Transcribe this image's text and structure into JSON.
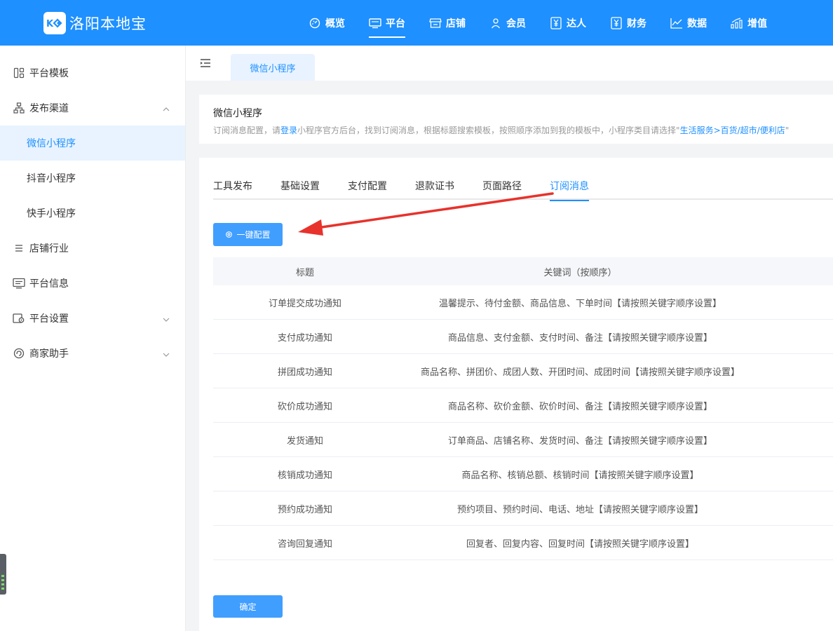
{
  "brand": {
    "name": "洛阳本地宝",
    "logo_icon": "ko-logo-icon"
  },
  "topnav": [
    {
      "label": "概览",
      "icon": "dashboard-icon",
      "active": false
    },
    {
      "label": "平台",
      "icon": "monitor-icon",
      "active": true
    },
    {
      "label": "店铺",
      "icon": "store-icon",
      "active": false
    },
    {
      "label": "会员",
      "icon": "user-icon",
      "active": false
    },
    {
      "label": "达人",
      "icon": "yen-icon",
      "active": false
    },
    {
      "label": "财务",
      "icon": "yen-icon",
      "active": false
    },
    {
      "label": "数据",
      "icon": "line-chart-icon",
      "active": false
    },
    {
      "label": "增值",
      "icon": "growth-icon",
      "active": false
    }
  ],
  "sidebar": {
    "items": [
      {
        "label": "平台模板",
        "icon": "template-icon"
      },
      {
        "label": "发布渠道",
        "icon": "org-chart-icon",
        "expanded": true,
        "children": [
          {
            "label": "微信小程序",
            "active": true
          },
          {
            "label": "抖音小程序",
            "active": false
          },
          {
            "label": "快手小程序",
            "active": false
          }
        ]
      },
      {
        "label": "店铺行业",
        "icon": "list-icon"
      },
      {
        "label": "平台信息",
        "icon": "message-icon"
      },
      {
        "label": "平台设置",
        "icon": "settings-icon",
        "expanded": false
      },
      {
        "label": "商家助手",
        "icon": "assistant-icon",
        "expanded": false
      }
    ]
  },
  "page_tab": {
    "label": "微信小程序"
  },
  "info": {
    "title": "微信小程序",
    "desc_prefix": "订阅消息配置，请",
    "desc_link": "登录",
    "desc_middle": "小程序官方后台，找到订阅消息，根据标题搜索模板，按照顺序添加到我的模板中，小程序类目请选择\"",
    "desc_category": "生活服务>百货/超市/便利店",
    "desc_suffix": "\""
  },
  "subtabs": [
    {
      "label": "工具发布",
      "active": false
    },
    {
      "label": "基础设置",
      "active": false
    },
    {
      "label": "支付配置",
      "active": false
    },
    {
      "label": "退款证书",
      "active": false
    },
    {
      "label": "页面路径",
      "active": false
    },
    {
      "label": "订阅消息",
      "active": true
    }
  ],
  "config_button": {
    "label": "一键配置",
    "icon": "gear-icon"
  },
  "table": {
    "headers": {
      "title": "标题",
      "keywords": "关键词（按顺序）"
    },
    "rows": [
      {
        "title": "订单提交成功通知",
        "keywords": "温馨提示、待付金额、商品信息、下单时间【请按照关键字顺序设置】"
      },
      {
        "title": "支付成功通知",
        "keywords": "商品信息、支付金额、支付时间、备注【请按照关键字顺序设置】"
      },
      {
        "title": "拼团成功通知",
        "keywords": "商品名称、拼团价、成团人数、开团时间、成团时间【请按照关键字顺序设置】"
      },
      {
        "title": "砍价成功通知",
        "keywords": "商品名称、砍价金额、砍价时间、备注【请按照关键字顺序设置】"
      },
      {
        "title": "发货通知",
        "keywords": "订单商品、店铺名称、发货时间、备注【请按照关键字顺序设置】"
      },
      {
        "title": "核销成功通知",
        "keywords": "商品名称、核销总额、核销时间【请按照关键字顺序设置】"
      },
      {
        "title": "预约成功通知",
        "keywords": "预约项目、预约时间、电话、地址【请按照关键字顺序设置】"
      },
      {
        "title": "咨询回复通知",
        "keywords": "回复者、回复内容、回复时间【请按照关键字顺序设置】"
      }
    ]
  },
  "confirm_button": {
    "label": "确定"
  },
  "colors": {
    "primary": "#1e90ff",
    "button": "#409eff",
    "arrow": "#e8322c"
  }
}
